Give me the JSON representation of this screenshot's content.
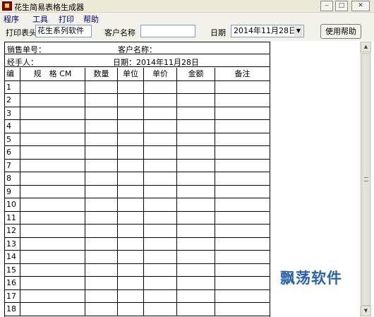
{
  "window": {
    "title": "花生简易表格生成器"
  },
  "menu": [
    "程序",
    "工具",
    "打印",
    "帮助"
  ],
  "toolbar": {
    "print_header_label": "打印表头",
    "print_header_value": "花生系列软件",
    "customer_label": "客户名称",
    "customer_value": "",
    "date_label": "日期",
    "date_value": "2014年11月28日",
    "help_button": "使用帮助"
  },
  "sheet": {
    "sales_no_label": "销售单号：",
    "customer_label": "客户名称：",
    "handler_label": "经手人：",
    "date_line": "日期：2014年11月28日",
    "columns": [
      "编号",
      "规　格 CM",
      "数量",
      "单位",
      "单价",
      "金额",
      "备注"
    ],
    "row_numbers": [
      "1",
      "2",
      "3",
      "4",
      "5",
      "6",
      "7",
      "8",
      "9",
      "10",
      "11",
      "12",
      "13",
      "14",
      "15",
      "16",
      "17",
      "18"
    ]
  },
  "watermark": "飘荡软件",
  "icons": {
    "app": "app-icon",
    "minimize": "minimize-icon",
    "maximize": "maximize-icon",
    "close": "close-icon",
    "dropdown": "chevron-down-icon"
  }
}
